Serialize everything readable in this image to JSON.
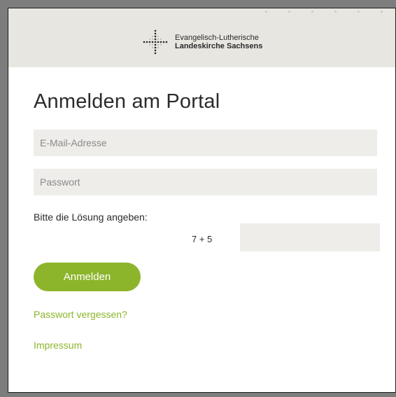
{
  "brand": {
    "line1": "Evangelisch-Lutherische",
    "line2": "Landeskirche Sachsens",
    "logo_icon": "cross-dots-icon",
    "accent_color": "#8cb52b"
  },
  "page": {
    "title": "Anmelden am Portal"
  },
  "form": {
    "email_placeholder": "E-Mail-Adresse",
    "email_value": "",
    "password_placeholder": "Passwort",
    "password_value": "",
    "captcha_label": "Bitte die Lösung angeben:",
    "captcha_question": "7 + 5",
    "captcha_value": "",
    "submit_label": "Anmelden"
  },
  "links": {
    "forgot_password": "Passwort vergessen?",
    "imprint": "Impressum"
  }
}
